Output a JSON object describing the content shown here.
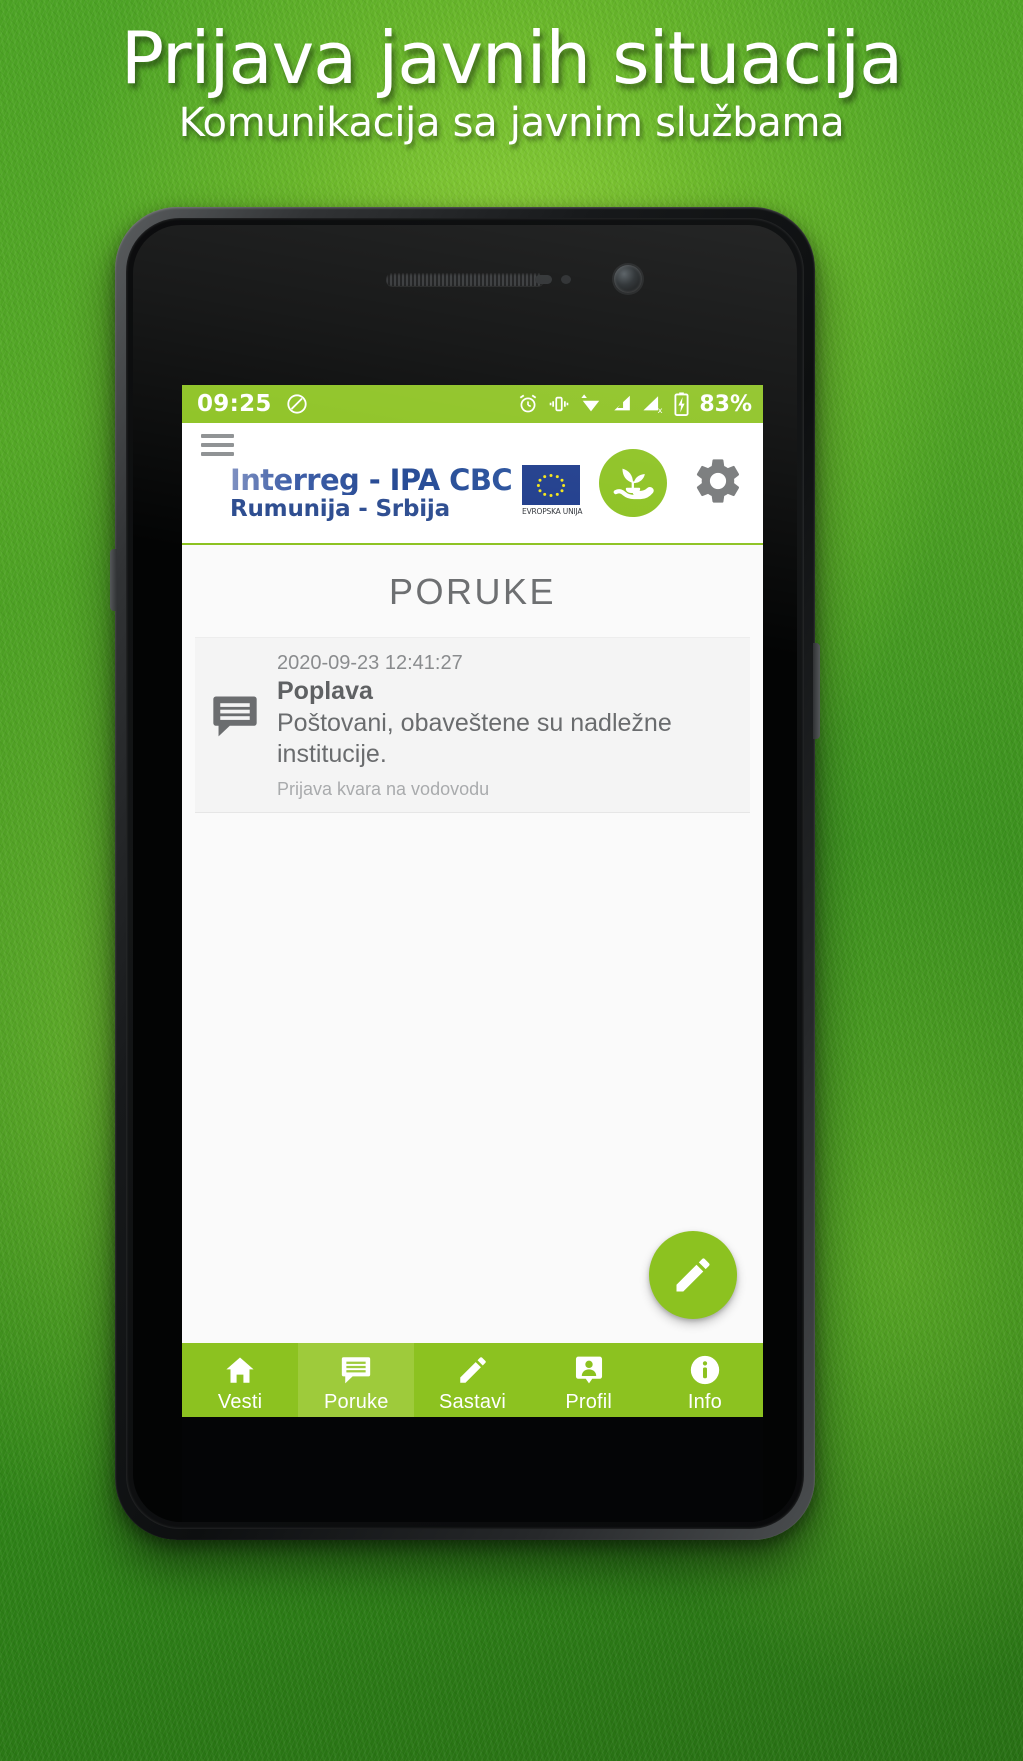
{
  "promo": {
    "title": "Prijava javnih situacija",
    "subtitle": "Komunikacija sa javnim službama"
  },
  "statusbar": {
    "time": "09:25",
    "battery_percent": "83%",
    "icons": [
      "do-not-disturb-icon",
      "alarm-icon",
      "vibrate-icon",
      "wifi-icon",
      "signal-icon",
      "signal-off-icon",
      "battery-charging-icon"
    ]
  },
  "appheader": {
    "menu_icon": "hamburger-menu-icon",
    "brand_line1": "Interreg - IPA CBC",
    "brand_line2": "Rumunija - Srbija",
    "eu_label": "EVROPSKA UNIJA",
    "logo_icon": "plant-in-hand-icon",
    "settings_icon": "gear-icon"
  },
  "main": {
    "page_title": "PORUKE",
    "messages": [
      {
        "icon": "message-icon",
        "date": "2020-09-23 12:41:27",
        "title": "Poplava",
        "text": "Poštovani, obaveštene su nadležne institucije.",
        "subject": "Prijava kvara na vodovodu"
      }
    ],
    "fab_icon": "pencil-icon"
  },
  "bottomnav": {
    "items": [
      {
        "label": "Vesti",
        "icon": "home-icon",
        "active": false
      },
      {
        "label": "Poruke",
        "icon": "message-icon",
        "active": true
      },
      {
        "label": "Sastavi",
        "icon": "pencil-icon",
        "active": false
      },
      {
        "label": "Profil",
        "icon": "person-icon",
        "active": false
      },
      {
        "label": "Info",
        "icon": "info-icon",
        "active": false
      }
    ]
  },
  "colors": {
    "brand_green": "#8cc220",
    "brand_green_light": "#9ecb3b",
    "brand_blue": "#2b4b8f",
    "bg_green": "#3f9a21"
  }
}
